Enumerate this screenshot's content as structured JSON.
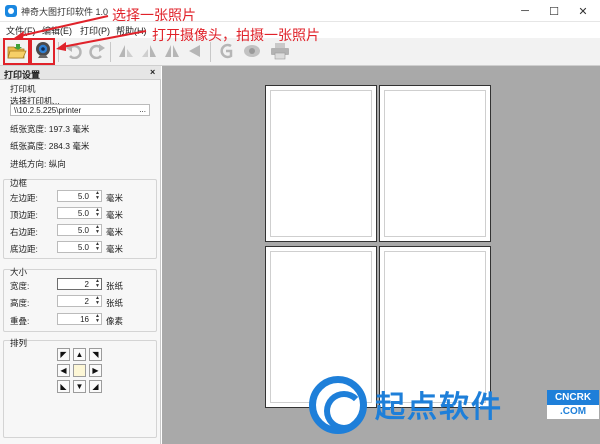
{
  "window": {
    "title": "神奇大图打印软件 1.0",
    "min_glyph": "─",
    "max_glyph": "☐",
    "close_glyph": "✕"
  },
  "menu": {
    "file": "文件(F)",
    "edit": "编辑(E)",
    "print": "打印(P)",
    "help": "帮助(H)"
  },
  "toolbar": {
    "buttons": [
      {
        "name": "open-photo",
        "icon": "folder-open-icon",
        "highlighted": true
      },
      {
        "name": "camera-capture",
        "icon": "webcam-icon",
        "highlighted": true
      },
      {
        "name": "undo",
        "icon": "undo-icon",
        "highlighted": false
      },
      {
        "name": "redo",
        "icon": "redo-icon",
        "highlighted": false
      },
      {
        "name": "flip-left",
        "icon": "flip-left-icon",
        "highlighted": false
      },
      {
        "name": "flip-right",
        "icon": "flip-right-icon",
        "highlighted": false
      },
      {
        "name": "mirror-horizontal",
        "icon": "mirror-horizontal-icon",
        "highlighted": false
      },
      {
        "name": "rotate",
        "icon": "rotate-icon",
        "highlighted": false
      },
      {
        "name": "grayscale",
        "icon": "g-letter-icon",
        "highlighted": false
      },
      {
        "name": "print-preview",
        "icon": "eye-icon",
        "highlighted": false
      },
      {
        "name": "print",
        "icon": "printer-icon",
        "highlighted": false
      }
    ]
  },
  "annotations": {
    "callout1": "选择一张照片",
    "callout2": "打开摄像头，拍摄一张照片",
    "color": "#e0222a"
  },
  "panel": {
    "title": "打印设置",
    "close": "×",
    "printer_section": "打印机",
    "select_printer": "选择打印机...",
    "printer_path": "\\\\10.2.5.225\\printer",
    "browse": "...",
    "paper_width": "纸张宽度: 197.3 毫米",
    "paper_height": "纸张高度: 284.3 毫米",
    "paper_direction": "进纸方向: 纵向",
    "margin_section": "边框",
    "margins": [
      {
        "label": "左边距:",
        "value": "5.0",
        "unit": "毫米"
      },
      {
        "label": "顶边距:",
        "value": "5.0",
        "unit": "毫米"
      },
      {
        "label": "右边距:",
        "value": "5.0",
        "unit": "毫米"
      },
      {
        "label": "底边距:",
        "value": "5.0",
        "unit": "毫米"
      }
    ],
    "size_section": "大小",
    "sizes": [
      {
        "label": "宽度:",
        "value": "2",
        "unit": "张纸"
      },
      {
        "label": "高度:",
        "value": "2",
        "unit": "张纸"
      },
      {
        "label": "重叠:",
        "value": "16",
        "unit": "像素"
      }
    ],
    "arrange_section": "排列",
    "arrange_glyphs": [
      "◤",
      "▲",
      "◥",
      "◀",
      "",
      "▶",
      "◣",
      "▼",
      "◢"
    ]
  },
  "canvas": {
    "pages_across": 2,
    "pages_down": 2,
    "background": "#a9a9a9"
  },
  "watermark": {
    "text": "起点软件",
    "badge_top": "CNCRK",
    "badge_bottom": ".COM",
    "color": "#1e7fd9"
  }
}
